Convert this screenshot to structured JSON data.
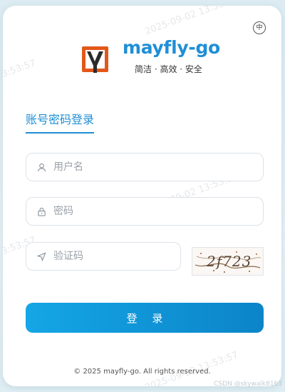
{
  "header": {
    "lang_icon_label": "中",
    "brand_name": "mayfly-go",
    "slogan": "简洁 · 高效 · 安全"
  },
  "tab": {
    "label": "账号密码登录"
  },
  "form": {
    "username_placeholder": "用户名",
    "password_placeholder": "密码",
    "captcha_placeholder": "验证码",
    "captcha_text": "2f723",
    "submit_label": "登 录"
  },
  "footer": {
    "copyright": "© 2025 mayfly-go. All rights reserved."
  },
  "watermark": {
    "text": "2025-09-02 13:53:57"
  },
  "site_mark": "CSDN @skywalk8163",
  "icons": {
    "lang": "globe-lang-icon",
    "user": "user-icon",
    "lock": "lock-icon",
    "captcha": "send-arrow-icon"
  },
  "colors": {
    "accent": "#1f8fd6",
    "button_start": "#14a6e6",
    "button_end": "#0c84c8",
    "logo_orange": "#e2581a",
    "logo_dark": "#2b2b2b"
  }
}
